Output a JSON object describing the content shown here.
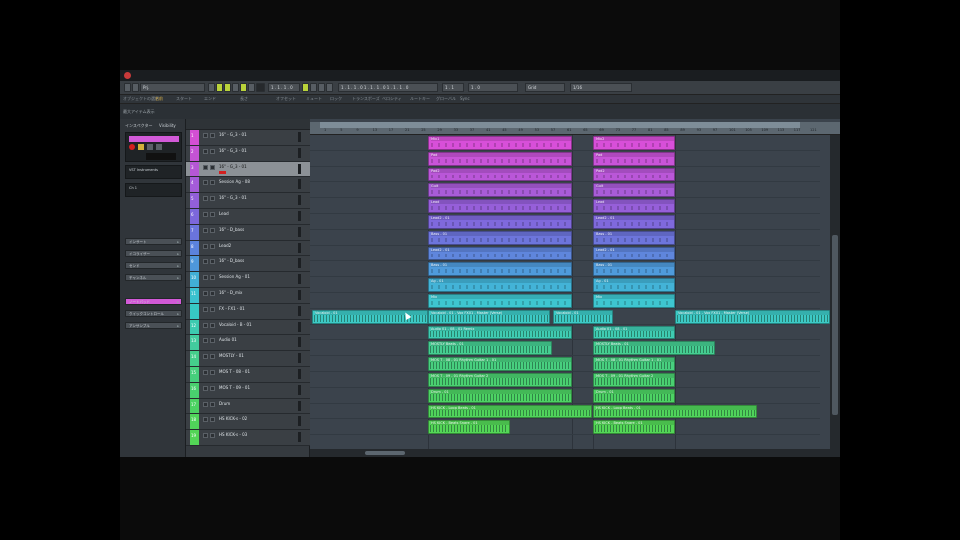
{
  "window": {
    "logo": "cubase-logo-icon"
  },
  "transport": {
    "fields": [
      "Prj.",
      "1 . 1 . 1 . 0",
      "1 . 1 . 1 . 0  1 . 1 . 1 . 0  1 . 1 . 1 . 0",
      "1 . 1",
      "1 . 0",
      "Grid",
      "1/16"
    ]
  },
  "infoline": {
    "items": [
      "オブジェクトの選択",
      "名前",
      "スタート",
      "エンド",
      "長さ",
      "オフセット",
      "ミュート",
      "ロック",
      "トランスポーズ",
      "ベロシティ",
      "ルートキー",
      "グローバル",
      "Sync"
    ],
    "highlight_index": 1
  },
  "status": {
    "text": "最大アイテム表示"
  },
  "inspector": {
    "tabs": [
      "インスペクター",
      "Visibility"
    ],
    "section_rows": [
      "インサート",
      "イコライザー",
      "センド",
      "チャンネル",
      "ノートパッド",
      "クイックコントロール",
      "アンサンブル"
    ],
    "top_box_label": "VST Instruments",
    "channel_label": "Ch 1",
    "colors": {
      "accent": "#d25ad8",
      "rec": "#d32020"
    }
  },
  "tracklist": {
    "tracks": [
      {
        "num": "1",
        "name": "16\" - G_3 - 01",
        "color": "#d34fd3"
      },
      {
        "num": "2",
        "name": "16\" - G_3 - 01",
        "color": "#c453d5"
      },
      {
        "num": "3",
        "name": "16\" - G_3 - 01",
        "color": "#b657d6"
      },
      {
        "num": "4",
        "name": "Session Ag - 08",
        "color": "#a45bd8"
      },
      {
        "num": "5",
        "name": "16\" - G_3 - 01",
        "color": "#925fd9"
      },
      {
        "num": "6",
        "name": "Lead",
        "color": "#7c67db"
      },
      {
        "num": "7",
        "name": "16\" - D_bass",
        "color": "#6a74dc"
      },
      {
        "num": "8",
        "name": "Lead2",
        "color": "#5b83dc"
      },
      {
        "num": "9",
        "name": "16\" - D_bass",
        "color": "#4e97db"
      },
      {
        "num": "10",
        "name": "Session Ag - 01",
        "color": "#41afd6"
      },
      {
        "num": "11",
        "name": "16\" - D_mix",
        "color": "#3ac2cf"
      },
      {
        "num": "",
        "name": "FX - FX1 - 01",
        "color": "#37c8c4"
      },
      {
        "num": "12",
        "name": "Vocaloid - B - 01",
        "color": "#3dcbb0"
      },
      {
        "num": "13",
        "name": "Audio 01",
        "color": "#42cc9e"
      },
      {
        "num": "14",
        "name": "MOSTLY - 01",
        "color": "#45cd8b"
      },
      {
        "num": "15",
        "name": "MOS T - 08 - 01",
        "color": "#46cf7c"
      },
      {
        "num": "16",
        "name": "MOS T - 09 - 01",
        "color": "#49d06e"
      },
      {
        "num": "17",
        "name": "Drum",
        "color": "#4cd262"
      },
      {
        "num": "18",
        "name": "HS KICK-s - 02",
        "color": "#50d45a"
      },
      {
        "num": "19",
        "name": "HS KICK-s - 03",
        "color": "#53d556"
      }
    ],
    "selected_index": 2
  },
  "ruler": {
    "marks": [
      "1",
      "5",
      "9",
      "13",
      "17",
      "21",
      "25",
      "29",
      "33",
      "37",
      "41",
      "45",
      "49",
      "53",
      "57",
      "61",
      "65",
      "69",
      "73",
      "77",
      "81",
      "85",
      "89",
      "93",
      "97",
      "101",
      "105",
      "109",
      "113",
      "117",
      "121"
    ]
  },
  "arranger": {
    "lanes": [
      {
        "color": "#d84fd9",
        "clips": [
          {
            "label": "Mix1"
          },
          {
            "label": "Mix2"
          }
        ]
      },
      {
        "color": "#c854d8",
        "clips": [
          {
            "label": "Pad"
          },
          {
            "label": "Pad"
          }
        ]
      },
      {
        "color": "#ba57d8",
        "clips": [
          {
            "label": "Pad2"
          },
          {
            "label": "Pad2"
          }
        ]
      },
      {
        "color": "#a85cd8",
        "clips": [
          {
            "label": "Guit"
          },
          {
            "label": "Guit"
          }
        ]
      },
      {
        "color": "#965fd9",
        "clips": [
          {
            "label": "Lead"
          },
          {
            "label": "Lead"
          }
        ]
      },
      {
        "color": "#7f69dc",
        "clips": [
          {
            "label": "Lead2 - 01"
          },
          {
            "label": "Lead2 - 01"
          }
        ]
      },
      {
        "color": "#6d75dc",
        "clips": [
          {
            "label": "Bass - 01"
          },
          {
            "label": "Bass - 01"
          }
        ]
      },
      {
        "color": "#5f86dc",
        "clips": [
          {
            "label": "Lead2 - 01"
          },
          {
            "label": "Lead2 - 01"
          }
        ]
      },
      {
        "color": "#4f9bdb",
        "clips": [
          {
            "label": "Bass - 01"
          },
          {
            "label": "Bass - 01"
          }
        ]
      },
      {
        "color": "#43b3d7",
        "clips": [
          {
            "label": "Ag - 01"
          },
          {
            "label": "Ag - 01"
          }
        ]
      },
      {
        "color": "#3ec6d0",
        "clips": [
          {
            "label": "Mix"
          },
          {
            "label": "Mix"
          }
        ]
      },
      {
        "color": "#3dc9c5",
        "clips": [
          {
            "label": "Vocaloid - 01"
          },
          {
            "label": "Vocaloid - 01"
          },
          {
            "label": "Vocaloid - 01 - Vox FX01 - Master (Verse)"
          },
          {
            "label": "Vocaloid - 01 - Vox FX01 - Master (Verse)"
          }
        ]
      },
      {
        "color": "#3fcbb2",
        "clips": [
          {
            "label": "Audio 01 - 08 - 01 Remix"
          },
          {
            "label": "Audio 01 - 08 - 01"
          }
        ]
      },
      {
        "color": "#45cd91",
        "clips": [
          {
            "label": "MOSTLY Beats - 01"
          },
          {
            "label": "MOSTLY Beats - 01"
          }
        ]
      },
      {
        "color": "#48cf7f",
        "clips": [
          {
            "label": "MOS T - 08 - 01 Rhythm Guitar 1 - 01"
          },
          {
            "label": "MOS T - 08 - 01 Rhythm Guitar 1 - 01"
          }
        ]
      },
      {
        "color": "#4ad070",
        "clips": [
          {
            "label": "MOS T - 09 - 01 Rhythm Guitar 2"
          },
          {
            "label": "MOS T - 09 - 01 Rhythm Guitar 2"
          }
        ]
      },
      {
        "color": "#4dd264",
        "clips": [
          {
            "label": "Drum - 01"
          },
          {
            "label": "Drum - 01"
          }
        ]
      },
      {
        "color": "#50d45b",
        "clips": [
          {
            "label": "HS KICK - Loop Beats - 01"
          },
          {
            "label": "HS KICK - Loop Beats - 01"
          }
        ]
      },
      {
        "color": "#54d657",
        "clips": [
          {
            "label": "HS KICK - Beats Snare - 01"
          },
          {
            "label": "HS KICK - Beats Snare - 01"
          }
        ]
      }
    ]
  }
}
